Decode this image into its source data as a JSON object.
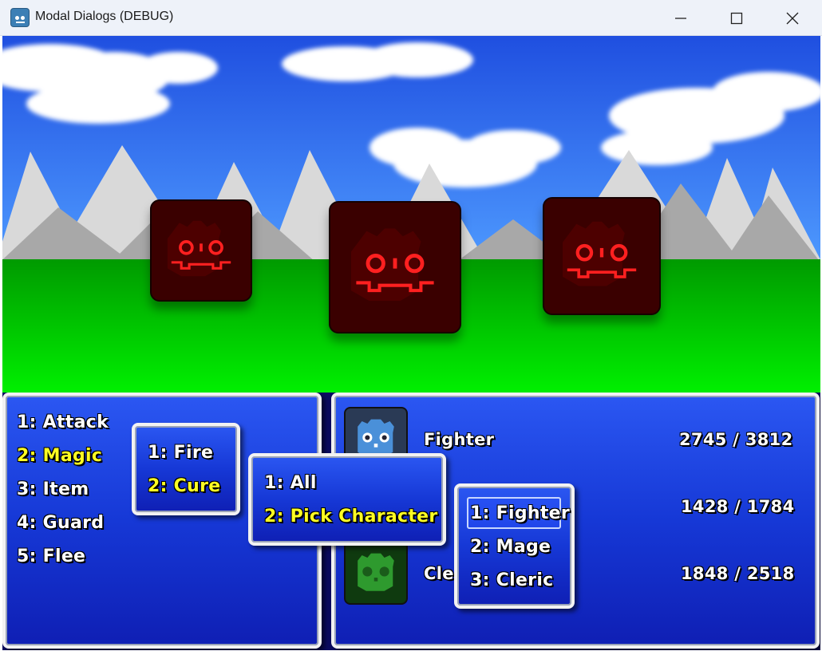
{
  "window": {
    "title": "Modal Dialogs (DEBUG)",
    "buttons": [
      "minimize-icon",
      "maximize-icon",
      "close-icon"
    ]
  },
  "action_menu": {
    "items": [
      "1: Attack",
      "2: Magic",
      "3: Item",
      "4: Guard",
      "5: Flee"
    ],
    "selected_index": 1
  },
  "magic_menu": {
    "items": [
      "1: Fire",
      "2: Cure"
    ],
    "selected_index": 1
  },
  "target_menu": {
    "items": [
      "1: All",
      "2: Pick Character"
    ],
    "selected_index": 1
  },
  "party": [
    {
      "name": "Fighter",
      "hp": "2745 / 3812",
      "portrait_color": "#4a90d9"
    },
    {
      "name": "",
      "hp": "1428 / 1784",
      "portrait_color": "#9b59b6"
    },
    {
      "name": "Cle",
      "hp": "1848 / 2518",
      "portrait_color": "#2e9a2e"
    }
  ],
  "character_picker": {
    "items": [
      "1: Fighter",
      "2: Mage",
      "3: Cleric"
    ],
    "highlighted_index": 0
  },
  "colors": {
    "menu_selected": "#ffff22",
    "menu_text": "#ffffff",
    "panel_blue": "#1638d6",
    "enemy_glow": "#ff2020",
    "grass": "#00cc00",
    "sky": "#2e6cf0"
  }
}
